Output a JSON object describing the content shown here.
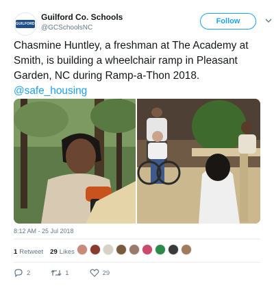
{
  "header": {
    "name": "Guilford Co. Schools",
    "handle": "@GCSchoolsNC",
    "follow_label": "Follow",
    "avatar_logo_text": "GUILFORD"
  },
  "tweet": {
    "text": "Chasmine Huntley, a freshman at The Academy at Smith, is building a wheelchair ramp in Pleasant Garden, NC during Ramp-a-Thon 2018.",
    "link": "@safe_housing"
  },
  "meta": {
    "timestamp": "8:12 AM - 25 Jul 2018"
  },
  "stats": {
    "retweets_count": "1",
    "retweets_label": "Retweet",
    "likes_count": "29",
    "likes_label": "Likes",
    "liker_colors": [
      "#c98a7a",
      "#8a3b2c",
      "#d9d2c4",
      "#7a5a3a",
      "#9a7a6a",
      "#c94a6a",
      "#2c8a4a",
      "#3a3a3a",
      "#a07a5a"
    ]
  },
  "actions": {
    "reply_count": "2",
    "retweet_count": "1",
    "like_count": "29"
  },
  "colors": {
    "accent": "#1da1f2",
    "text": "#14171a",
    "muted": "#657786"
  }
}
